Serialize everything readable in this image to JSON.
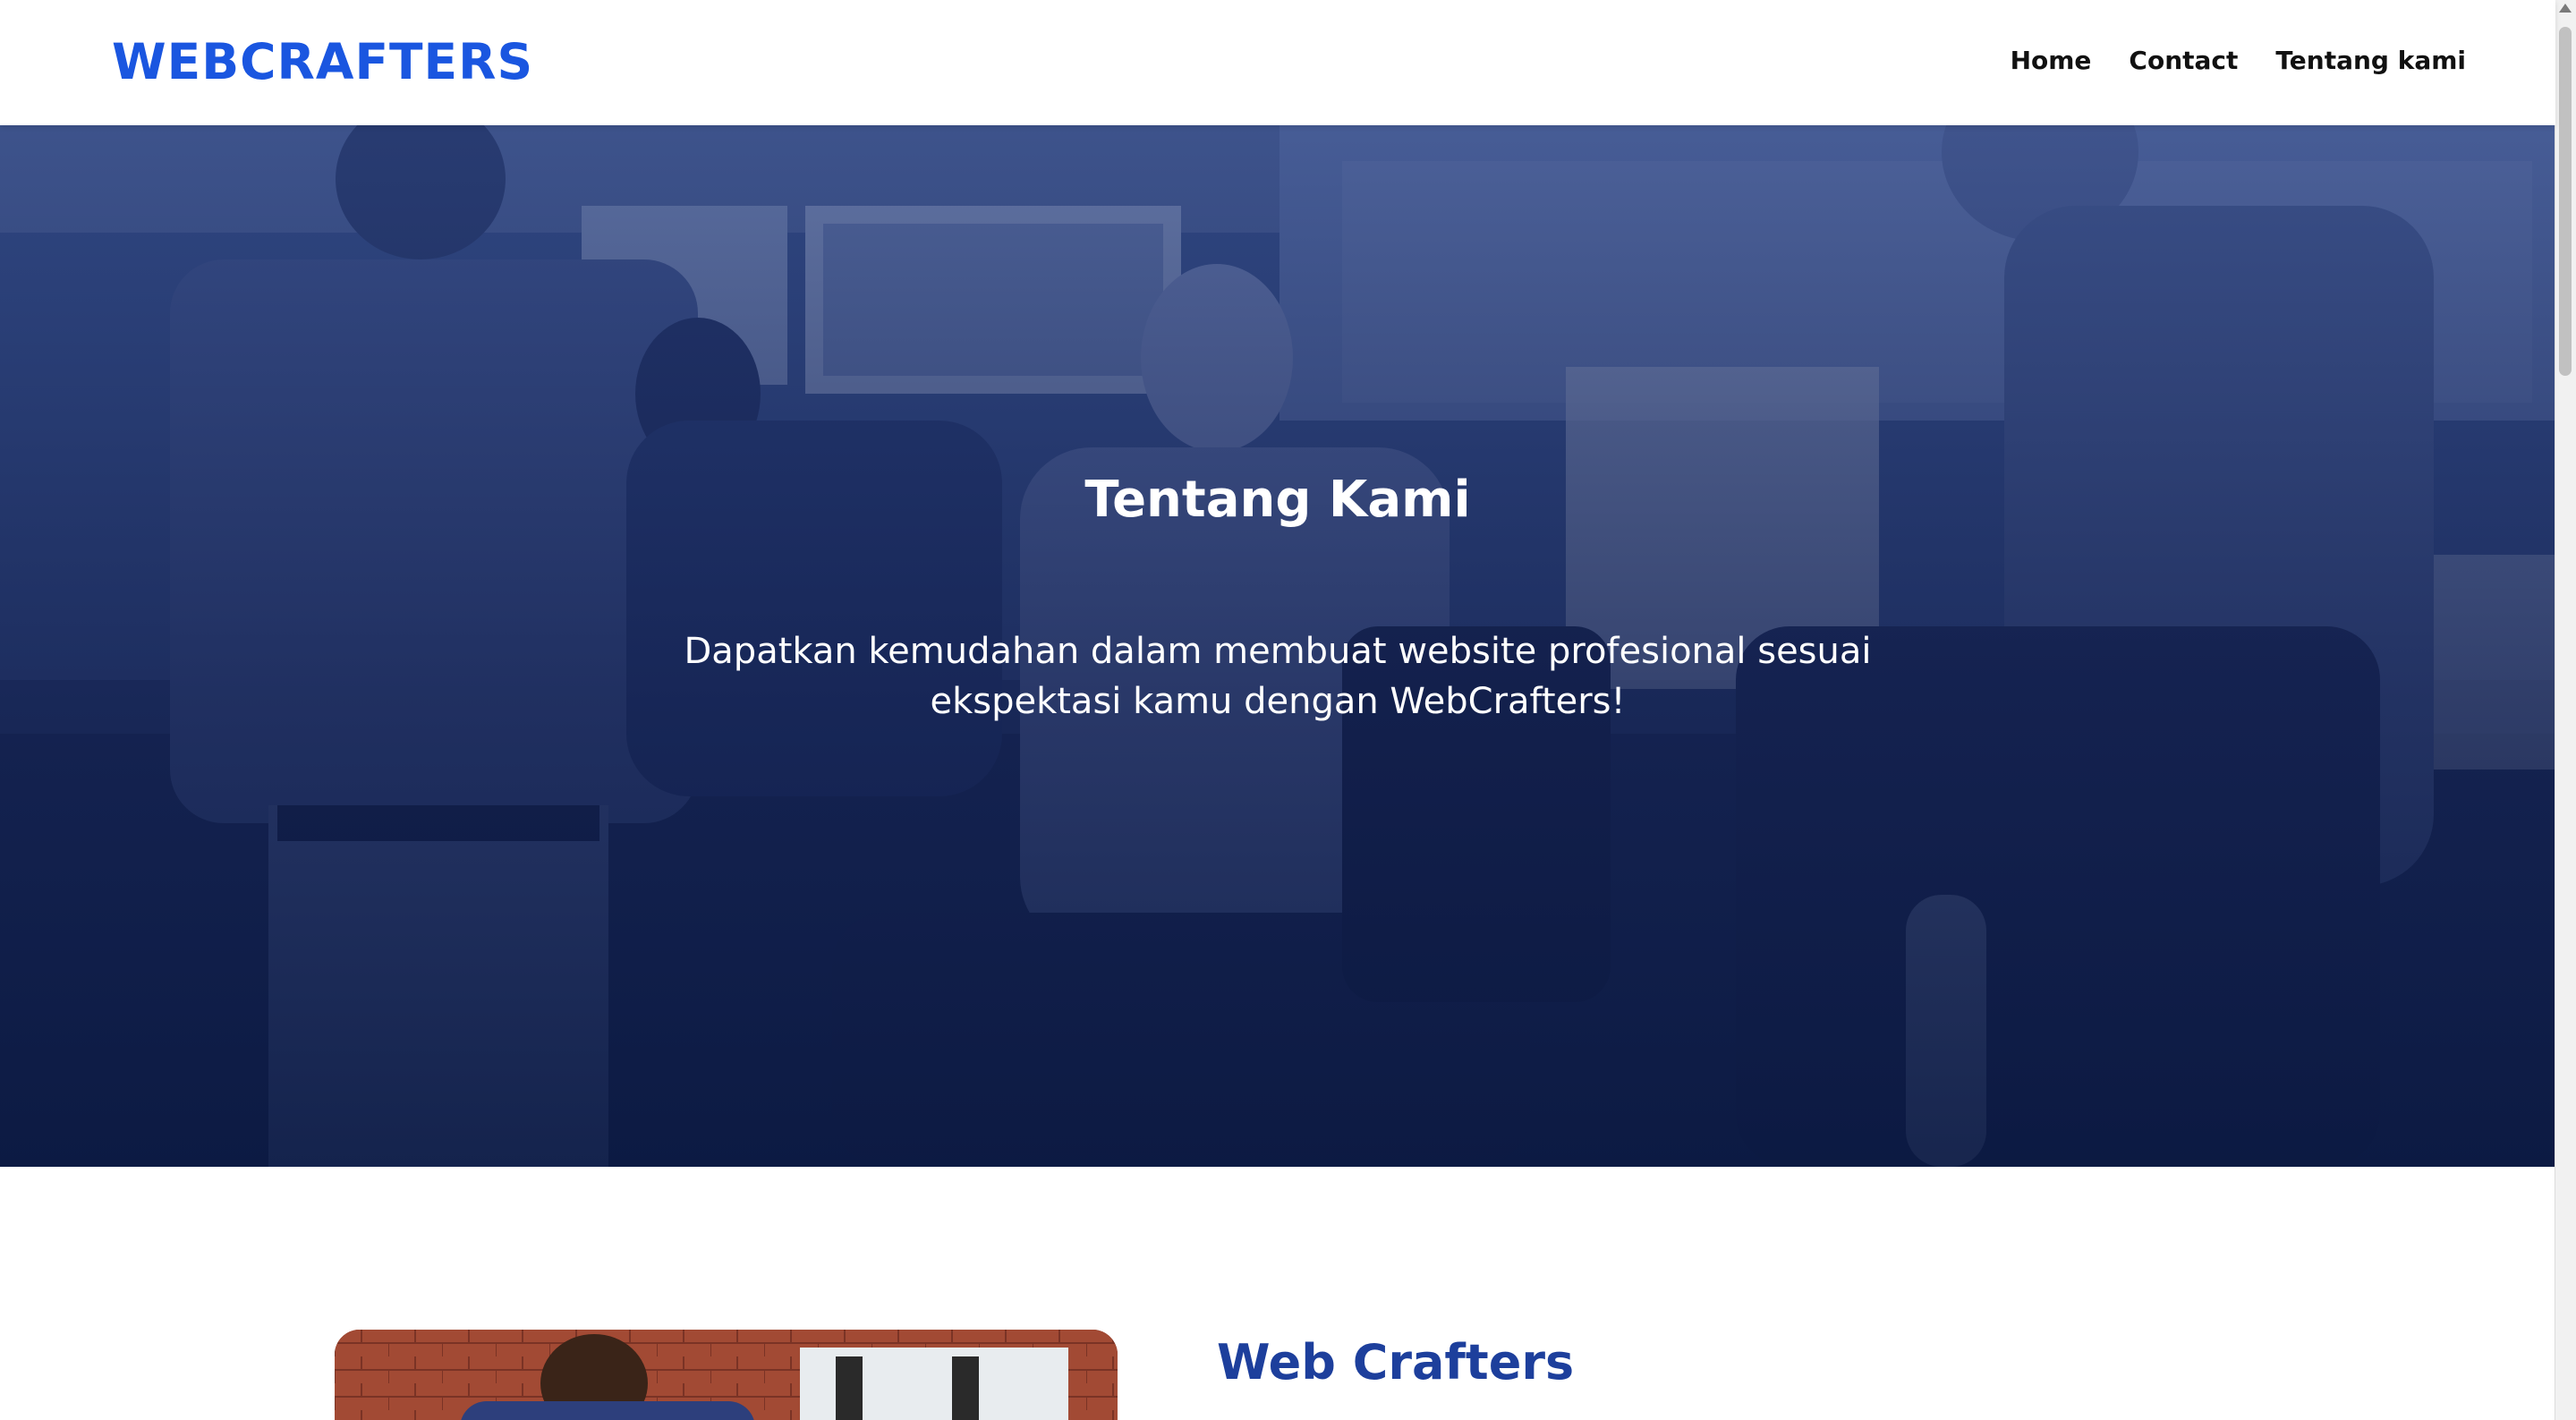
{
  "header": {
    "logo": "WEBCRAFTERS",
    "nav": [
      {
        "label": "Home"
      },
      {
        "label": "Contact"
      },
      {
        "label": "Tentang kami"
      }
    ]
  },
  "hero": {
    "title": "Tentang Kami",
    "subtitle": "Dapatkan kemudahan dalam membuat website profesional sesuai ekspektasi kamu dengan WebCrafters!"
  },
  "about": {
    "heading": "Web Crafters"
  },
  "colors": {
    "brand": "#1a56e0",
    "heading": "#1d3f9c",
    "hero_overlay": "#12204e"
  }
}
